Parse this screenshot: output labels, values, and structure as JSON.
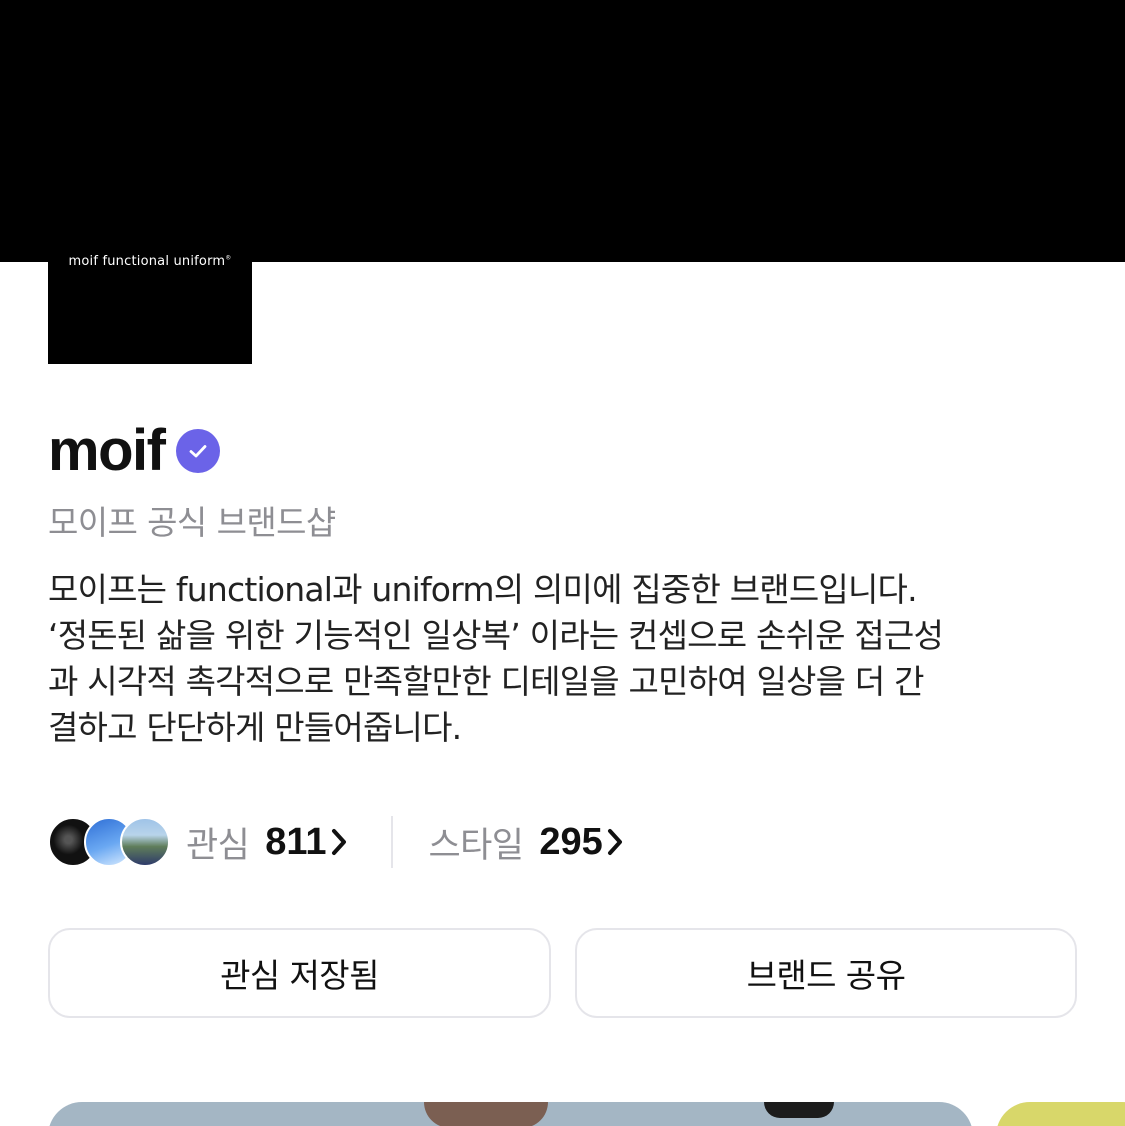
{
  "logo": {
    "text": "moif  functional  uniform",
    "mark": "®"
  },
  "brand": {
    "name": "moif",
    "verified_icon": "verified-check-icon",
    "subtitle": "모이프 공식 브랜드샵",
    "description": [
      "모이프는 functional과 uniform의 의미에 집중한 브랜드입니다.",
      "‘정돈된 삶을 위한 기능적인 일상복’ 이라는 컨셉으로 손쉬운 접근성",
      "과  시각적 촉각적으로 만족할만한 디테일을 고민하여 일상을 더 간",
      "결하고 단단하게 만들어줍니다."
    ]
  },
  "stats": {
    "interest": {
      "label": "관심",
      "value": "811"
    },
    "style": {
      "label": "스타일",
      "value": "295"
    }
  },
  "buttons": {
    "save": "관심 저장됨",
    "share": "브랜드 공유"
  },
  "colors": {
    "accent": "#6b63e8",
    "muted_text": "#8e8e93",
    "border": "#e5e5ea"
  }
}
